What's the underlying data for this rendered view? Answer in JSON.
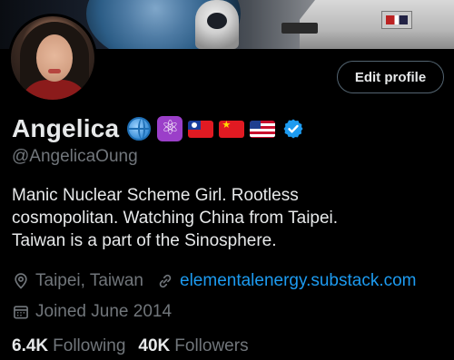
{
  "profile": {
    "name": "Angelica",
    "handle": "@AngelicaOung",
    "edit_label": "Edit profile",
    "name_emojis": [
      "globe-icon",
      "atom-symbol-icon",
      "taiwan-flag-icon",
      "china-flag-icon",
      "us-flag-icon",
      "verified-badge-icon"
    ],
    "bio_lines": [
      "Manic Nuclear Scheme Girl. Rootless",
      "cosmopolitan. Watching China from Taipei.",
      "Taiwan is a part of the Sinosphere."
    ],
    "location": "Taipei, Taiwan",
    "website": "elementalenergy.substack.com",
    "joined": "Joined June 2014",
    "following_count": "6.4K",
    "following_label": "Following",
    "followers_count": "40K",
    "followers_label": "Followers"
  },
  "colors": {
    "background": "#000000",
    "text": "#e7e9ea",
    "muted": "#71767b",
    "link": "#1d9bf0",
    "verified": "#1d9bf0"
  }
}
